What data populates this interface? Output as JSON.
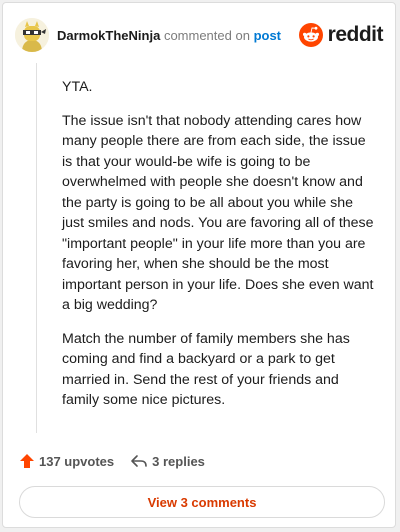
{
  "comment": {
    "username": "DarmokTheNinja",
    "action": "commented on",
    "post_link": "post",
    "paragraphs": [
      "YTA.",
      "The issue isn't that nobody attending cares how many people there are from each side, the issue is that your would-be wife is going to be overwhelmed with people she doesn't know and the party is going to be all about you while she just smiles and nods. You are favoring all of these \"important people\" in your life more than you are favoring her, when she should be the most important person in your life. Does she even want a big wedding?",
      "Match the number of family members she has coming and find a backyard or a park to get married in. Send the rest of your friends and family some nice pictures."
    ]
  },
  "brand": {
    "name": "reddit",
    "icon": "reddit-logo-icon",
    "color": "#ff4500"
  },
  "footer": {
    "upvotes": "137 upvotes",
    "replies": "3 replies",
    "upvote_icon": "upvote-arrow-icon",
    "reply_icon": "reply-arrow-icon",
    "upvote_color": "#ff4500"
  },
  "view_button": {
    "label": "View 3 comments",
    "color": "#d93a00"
  }
}
